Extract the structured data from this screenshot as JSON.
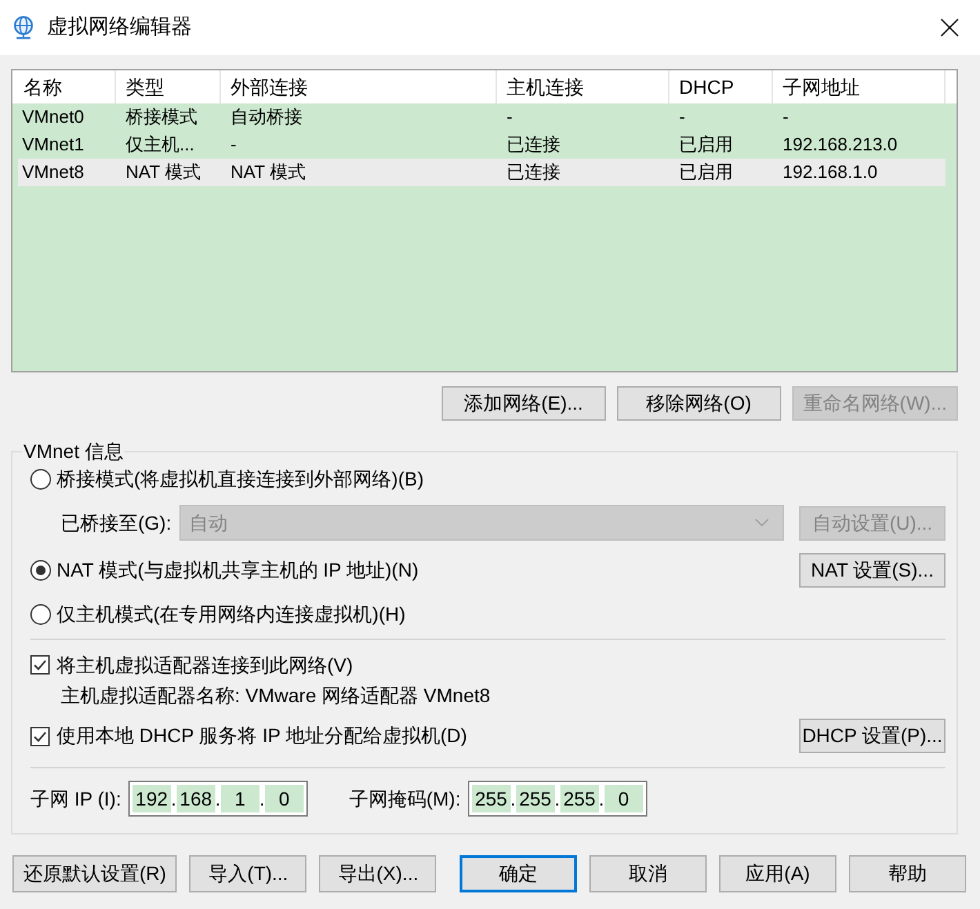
{
  "window": {
    "title": "虚拟网络编辑器"
  },
  "table": {
    "columns": [
      "名称",
      "类型",
      "外部连接",
      "主机连接",
      "DHCP",
      "子网地址"
    ],
    "rows": [
      {
        "cells": [
          "VMnet0",
          "桥接模式",
          "自动桥接",
          "-",
          "-",
          "-"
        ],
        "selected": false
      },
      {
        "cells": [
          "VMnet1",
          "仅主机...",
          "-",
          "已连接",
          "已启用",
          "192.168.213.0"
        ],
        "selected": false
      },
      {
        "cells": [
          "VMnet8",
          "NAT 模式",
          "NAT 模式",
          "已连接",
          "已启用",
          "192.168.1.0"
        ],
        "selected": true
      }
    ]
  },
  "network_buttons": [
    {
      "label": "添加网络(E)...",
      "disabled": false
    },
    {
      "label": "移除网络(O)",
      "disabled": false
    },
    {
      "label": "重命名网络(W)...",
      "disabled": true
    }
  ],
  "vmnet_info": {
    "title": "VMnet 信息",
    "modes": [
      {
        "label": "桥接模式(将虚拟机直接连接到外部网络)(B)",
        "selected": false,
        "bridged_to": {
          "label": "已桥接至(G):",
          "value": "自动",
          "disabled": true,
          "button": {
            "label": "自动设置(U)...",
            "disabled": true
          }
        }
      },
      {
        "label": "NAT 模式(与虚拟机共享主机的 IP 地址)(N)",
        "selected": true,
        "button": {
          "label": "NAT 设置(S)...",
          "disabled": false
        }
      },
      {
        "label": "仅主机模式(在专用网络内连接虚拟机)(H)",
        "selected": false
      }
    ],
    "options": [
      {
        "label": "将主机虚拟适配器连接到此网络(V)",
        "checked": true,
        "note": "主机虚拟适配器名称: VMware 网络适配器 VMnet8"
      },
      {
        "label": "使用本地 DHCP 服务将 IP 地址分配给虚拟机(D)",
        "checked": true,
        "button": {
          "label": "DHCP 设置(P)...",
          "disabled": false
        }
      }
    ],
    "subnet_ip": {
      "label": "子网 IP (I):",
      "octets": [
        {
          "value": "192",
          "separator": "."
        },
        {
          "value": "168",
          "separator": "."
        },
        {
          "value": "1",
          "separator": "."
        },
        {
          "value": "0"
        }
      ]
    },
    "subnet_mask": {
      "label": "子网掩码(M):",
      "octets": [
        {
          "value": "255",
          "separator": "."
        },
        {
          "value": "255",
          "separator": "."
        },
        {
          "value": "255",
          "separator": "."
        },
        {
          "value": "0"
        }
      ]
    }
  },
  "footer": {
    "left_buttons": [
      {
        "label": "还原默认设置(R)"
      },
      {
        "label": "导入(T)..."
      },
      {
        "label": "导出(X)..."
      }
    ],
    "right_buttons": [
      {
        "label": "确定",
        "default": true
      },
      {
        "label": "取消",
        "default": false
      },
      {
        "label": "应用(A)",
        "default": false
      },
      {
        "label": "帮助",
        "default": false
      }
    ]
  }
}
